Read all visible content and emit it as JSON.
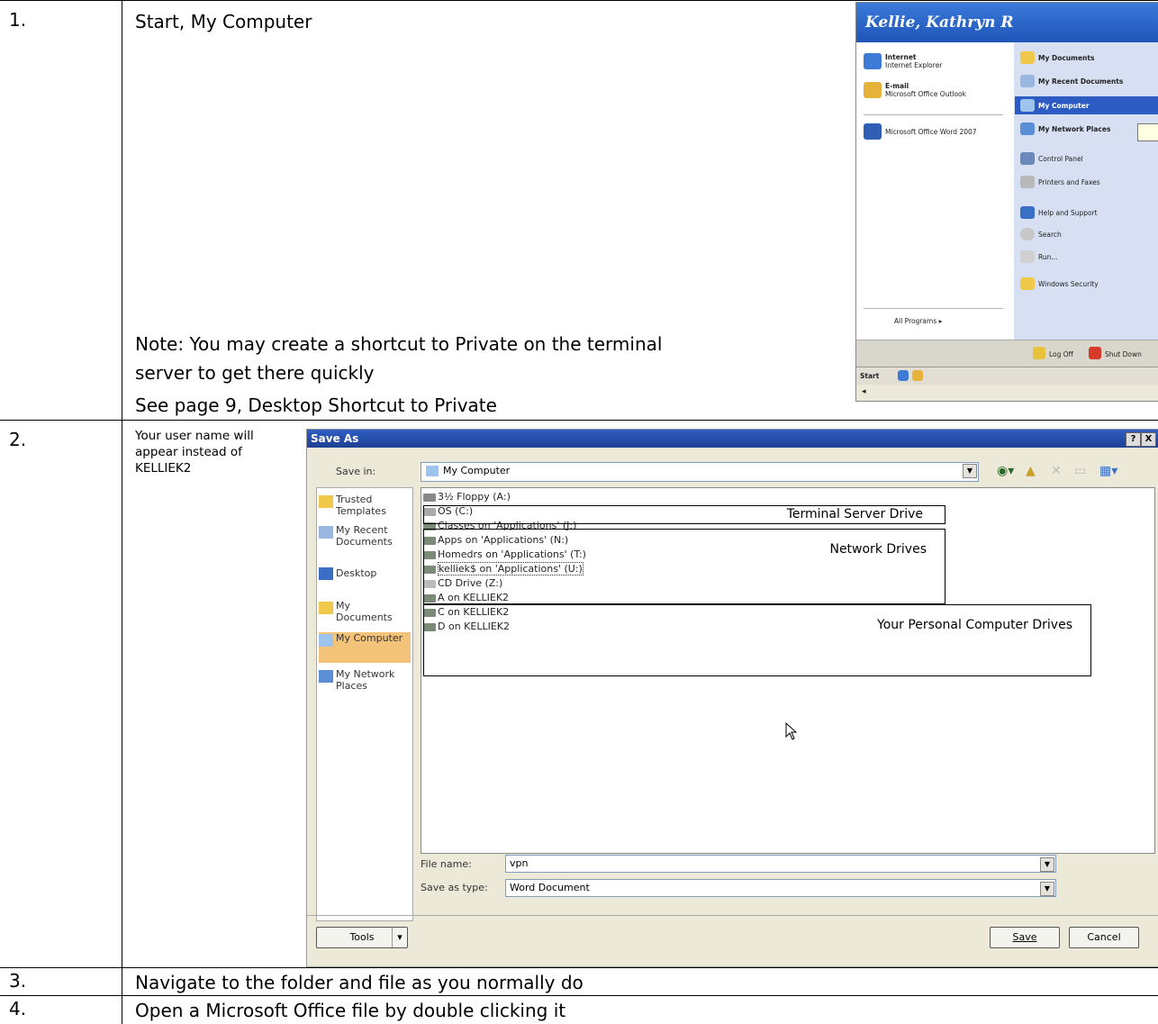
{
  "rows": [
    {
      "number": "1.",
      "text": "Start, My Computer",
      "note_lines": [
        "Note: You may create a shortcut to Private on the terminal",
        "server to get there quickly",
        "See page 9, Desktop Shortcut to Private"
      ]
    },
    {
      "number": "2.",
      "note": "Your user name will appear instead of KELLIEK2"
    },
    {
      "number": "3.",
      "text": "Navigate to the folder and file as you normally do"
    },
    {
      "number": "4.",
      "text": "Open a Microsoft Office file by double clicking it"
    }
  ],
  "start_menu": {
    "user": "Kellie, Kathryn R",
    "left_items": [
      {
        "title": "Internet",
        "sub": "Internet Explorer"
      },
      {
        "title": "E-mail",
        "sub": "Microsoft Office Outlook"
      },
      {
        "title": "Microsoft Office Word 2007",
        "sub": ""
      }
    ],
    "all_programs": "All Programs",
    "right_items": [
      "My Documents",
      "My Recent Documents",
      "My Computer",
      "My Network Places",
      "Control Panel",
      "Printers and Faxes",
      "Help and Support",
      "Search",
      "Run...",
      "Windows Security"
    ],
    "log_off": "Log Off",
    "shut_down": "Shut Down",
    "start_label": "Start"
  },
  "dialog": {
    "title": "Save As",
    "help_btn": "?",
    "close_btn": "X",
    "save_in_label": "Save in:",
    "save_in_value": "My Computer",
    "places": [
      "Trusted Templates",
      "My Recent Documents",
      "Desktop",
      "My Documents",
      "My Computer",
      "My Network Places"
    ],
    "files": [
      "3½ Floppy (A:)",
      "OS (C:)",
      "Classes on 'Applications' (J:)",
      "Apps on 'Applications' (N:)",
      "Homedrs on 'Applications' (T:)",
      "kelliek$ on 'Applications' (U:)",
      "CD Drive (Z:)",
      "A on KELLIEK2",
      "C on KELLIEK2",
      "D on KELLIEK2"
    ],
    "annotations": [
      "Terminal Server Drive",
      "Network Drives",
      "Your Personal Computer Drives"
    ],
    "file_name_label": "File name:",
    "file_name_value": "vpn",
    "save_type_label": "Save as type:",
    "save_type_value": "Word Document",
    "tools_btn": "Tools",
    "save_btn": "Save",
    "cancel_btn": "Cancel"
  }
}
